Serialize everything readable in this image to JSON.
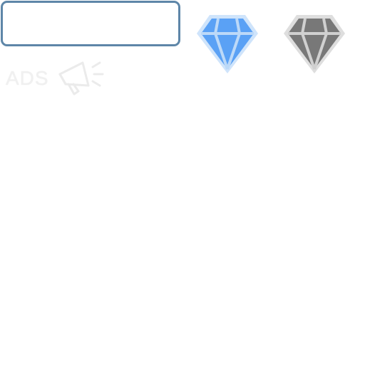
{
  "input": {
    "value": "",
    "border_color": "#5e86a8"
  },
  "gems": [
    {
      "icon": "diamond-icon",
      "fill": "#5aa1f5",
      "outline": "#cfe4fb",
      "stroke": "#bcd9f8",
      "state": "active"
    },
    {
      "icon": "diamond-icon",
      "fill": "#787878",
      "outline": "#dedede",
      "stroke": "#d0d0d0",
      "state": "inactive"
    }
  ],
  "ads": {
    "label": "ADS",
    "icon": "megaphone-icon",
    "color": "#f0f0f0"
  }
}
